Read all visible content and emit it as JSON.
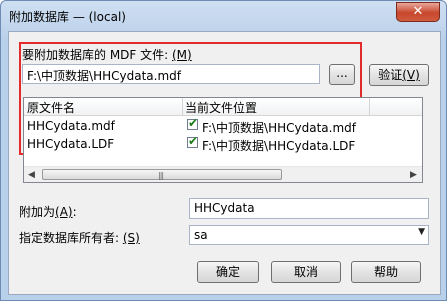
{
  "window": {
    "title": "附加数据库 — (local)",
    "close_glyph": "✕"
  },
  "mdf": {
    "label": "要附加数据库的 MDF 文件: ",
    "label_key": "(M)",
    "path": "F:\\中顶数据\\HHCydata.mdf",
    "browse_label": "...",
    "verify_label": "验证",
    "verify_key": "(V)"
  },
  "table": {
    "columns": [
      "原文件名",
      "当前文件位置"
    ],
    "rows": [
      {
        "name": "HHCydata.mdf",
        "location": "F:\\中顶数据\\HHCydata.mdf",
        "checked": true
      },
      {
        "name": "HHCydata.LDF",
        "location": "F:\\中顶数据\\HHCydata.LDF",
        "checked": true
      }
    ],
    "check_glyph": "✔"
  },
  "attach_as": {
    "label": "附加为",
    "key": "(A)",
    "colon": ":",
    "value": "HHCydata"
  },
  "owner": {
    "label": "指定数据库所有者: ",
    "key": "(S)",
    "value": "sa"
  },
  "buttons": {
    "ok": "确定",
    "cancel": "取消",
    "help": "帮助"
  },
  "icons": {
    "left_arrow": "◀",
    "right_arrow": "▶",
    "dropdown": "▼",
    "grip": "|||"
  },
  "colors": {
    "highlight_box": "#e32b2b",
    "check": "#1a7a1a"
  }
}
